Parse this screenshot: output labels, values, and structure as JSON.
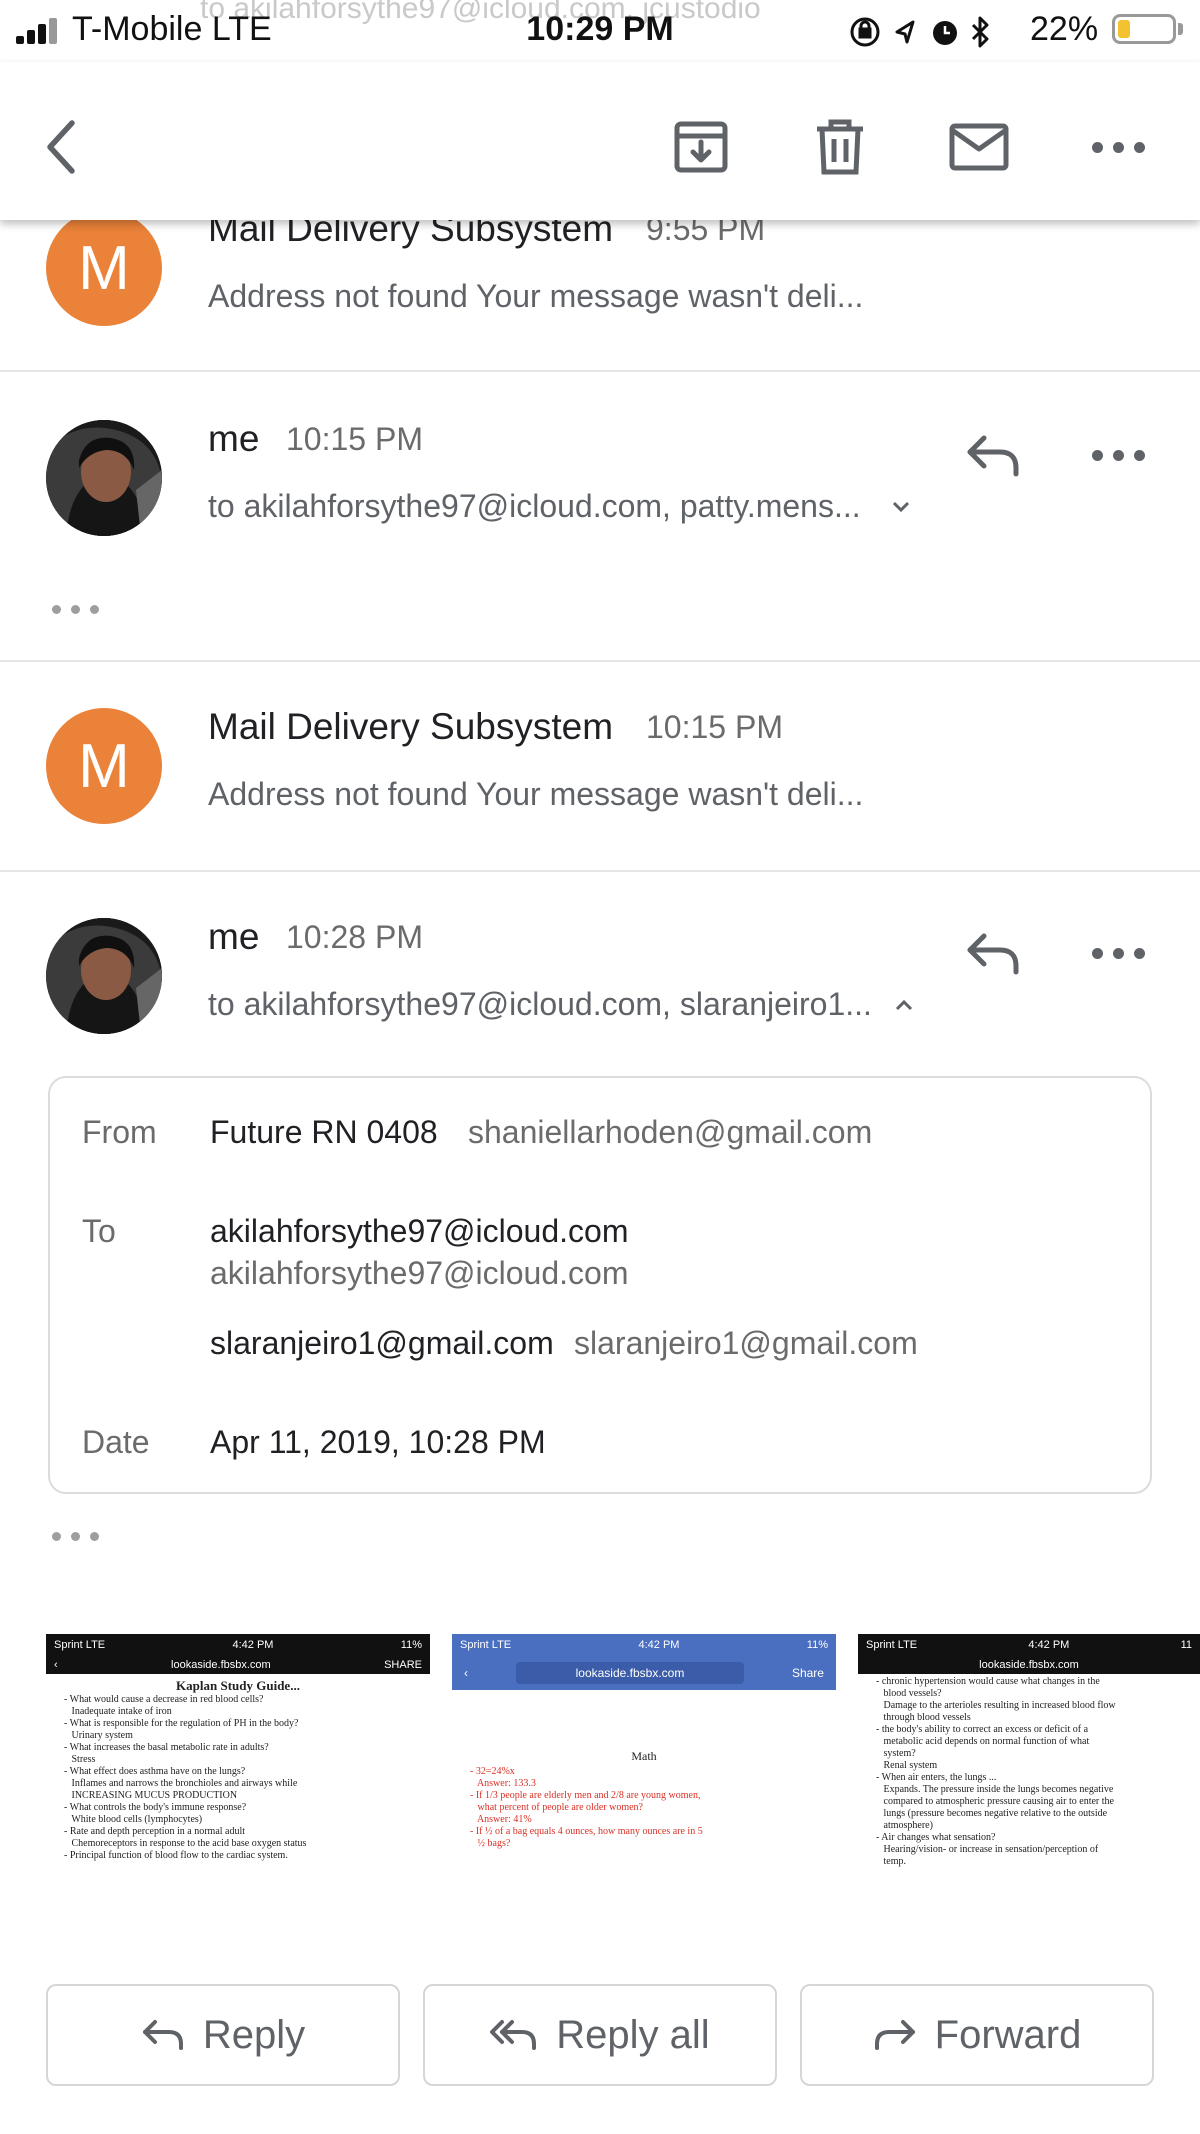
{
  "status_bar": {
    "carrier": "T-Mobile  LTE",
    "time": "10:29 PM",
    "battery_percent": "22%",
    "battery_level": 0.22,
    "battery_color": "#f2c230"
  },
  "faded_header_text": "to akilahforsythe97@icloud.com, jcustodio",
  "toolbar": {
    "back_icon": "arrow-left",
    "archive_icon": "archive",
    "delete_icon": "trash",
    "mark_unread_icon": "envelope",
    "more_icon": "more-horizontal"
  },
  "messages": [
    {
      "avatar_letter": "M",
      "sender": "Mail Delivery Subsystem",
      "time": "9:55 PM",
      "snippet": "Address not found Your message wasn't deli..."
    },
    {
      "sender": "me",
      "time": "10:15 PM",
      "recipients": "to akilahforsythe97@icloud.com, patty.mens..."
    },
    {
      "avatar_letter": "M",
      "sender": "Mail Delivery Subsystem",
      "time": "10:15 PM",
      "snippet": "Address not found Your message wasn't deli..."
    },
    {
      "sender": "me",
      "time": "10:28 PM",
      "recipients": "to akilahforsythe97@icloud.com, slaranjeiro1..."
    }
  ],
  "details": {
    "from_label": "From",
    "from_name": "Future RN 0408",
    "from_email": "shaniellarhoden@gmail.com",
    "to_label": "To",
    "to_1_name": "akilahforsythe97@icloud.com",
    "to_1_email": "akilahforsythe97@icloud.com",
    "to_2_name": "slaranjeiro1@gmail.com",
    "to_2_email": "slaranjeiro1@gmail.com",
    "date_label": "Date",
    "date_value": "Apr 11, 2019, 10:28 PM"
  },
  "attachments": [
    {
      "status_left": "Sprint  LTE",
      "status_time": "4:42 PM",
      "status_right": "11%",
      "url": "lookaside.fbsbx.com",
      "share": "SHARE",
      "title": "Kaplan Study Guide...",
      "lines": [
        "- What would cause a decrease in red blood cells?",
        "   Inadequate intake of iron",
        "- What is responsible for the regulation of PH in the body?",
        "   Urinary system",
        "- What increases the basal metabolic rate in adults?",
        "   Stress",
        "- What effect does asthma have on the lungs?",
        "   Inflames and narrows the bronchioles and airways while",
        "   INCREASING MUCUS PRODUCTION",
        "- What controls the body's immune response?",
        "   White blood cells (lymphocytes)",
        "- Rate and depth perception in a normal adult",
        "   Chemoreceptors in response to the acid base oxygen status",
        "- Principal function of blood flow to the cardiac system."
      ]
    },
    {
      "status_left": "Sprint  LTE",
      "status_time": "4:42 PM",
      "status_right": "11%",
      "url": "lookaside.fbsbx.com",
      "share": "Share",
      "title": "Math",
      "lines": [
        "- 32=24%x",
        "   Answer: 133.3",
        "- If 1/3 people are elderly men and 2/8 are young women,",
        "   what percent of people are older women?",
        "   Answer: 41%",
        "- If ½ of a bag equals 4 ounces, how many ounces are in 5",
        "   ½ bags?"
      ]
    },
    {
      "status_left": "Sprint  LTE",
      "status_time": "4:42 PM",
      "status_right": "11",
      "url": "lookaside.fbsbx.com",
      "lines": [
        "- chronic hypertension would cause what changes in the",
        "   blood vessels?",
        "   Damage to the arterioles resulting in increased blood flow",
        "   through blood vessels",
        "- the body's ability to correct an excess or deficit of a",
        "   metabolic acid depends on normal function of what",
        "   system?",
        "   Renal system",
        "- When air enters, the lungs ...",
        "   Expands. The pressure inside the lungs becomes negative",
        "   compared to atmospheric pressure causing air to enter the",
        "   lungs (pressure becomes negative relative to the outside",
        "   atmosphere)",
        "- Air changes what sensation?",
        "   Hearing/vision- or increase in sensation/perception of",
        "   temp."
      ]
    }
  ],
  "actions": {
    "reply": "Reply",
    "reply_all": "Reply all",
    "forward": "Forward"
  },
  "colors": {
    "avatar_orange": "#ea8239",
    "link_blue": "#4a6fc0",
    "math_red": "#d93025"
  }
}
